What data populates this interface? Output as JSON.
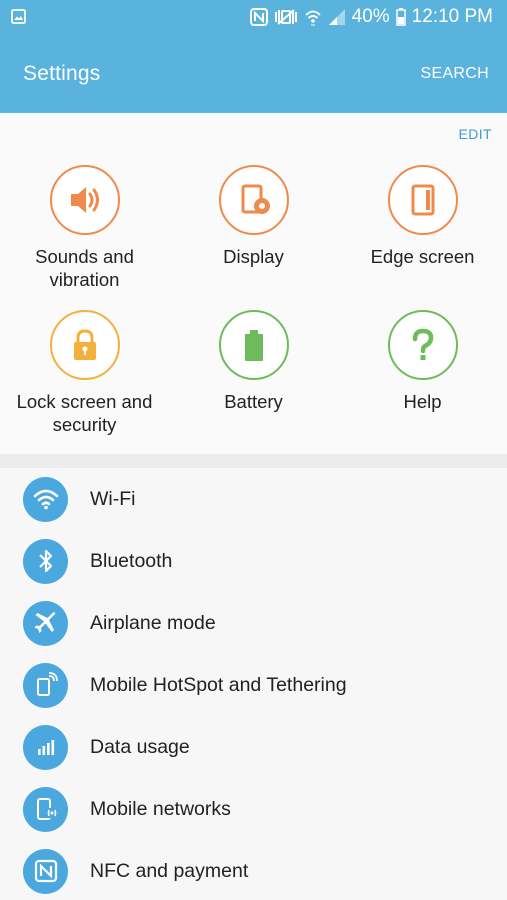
{
  "status_bar": {
    "battery_percent": "40%",
    "time": "12:10 PM",
    "icons": [
      "picture-icon",
      "nfc-icon",
      "vibrate-icon",
      "wifi-icon",
      "signal-icon",
      "battery-icon"
    ]
  },
  "appbar": {
    "title": "Settings",
    "search_label": "SEARCH"
  },
  "quick_settings": {
    "edit_label": "EDIT",
    "tiles": [
      {
        "label": "Sounds and vibration",
        "icon": "speaker-icon",
        "color": "#f08a4b"
      },
      {
        "label": "Display",
        "icon": "display-icon",
        "color": "#f08a4b"
      },
      {
        "label": "Edge screen",
        "icon": "edge-screen-icon",
        "color": "#f08a4b"
      },
      {
        "label": "Lock screen and security",
        "icon": "lock-icon",
        "color": "#f3b13b"
      },
      {
        "label": "Battery",
        "icon": "battery-icon",
        "color": "#6dbb5a"
      },
      {
        "label": "Help",
        "icon": "help-icon",
        "color": "#6dbb5a"
      }
    ]
  },
  "settings_list": [
    {
      "label": "Wi-Fi",
      "icon": "wifi-icon"
    },
    {
      "label": "Bluetooth",
      "icon": "bluetooth-icon"
    },
    {
      "label": "Airplane mode",
      "icon": "airplane-icon"
    },
    {
      "label": "Mobile HotSpot and Tethering",
      "icon": "hotspot-icon"
    },
    {
      "label": "Data usage",
      "icon": "data-usage-icon"
    },
    {
      "label": "Mobile networks",
      "icon": "mobile-networks-icon"
    },
    {
      "label": "NFC and payment",
      "icon": "nfc-icon"
    }
  ],
  "colors": {
    "header_blue": "#59b3dc",
    "list_icon_blue": "#4aa8df",
    "edit_blue": "#3e9bd0"
  }
}
